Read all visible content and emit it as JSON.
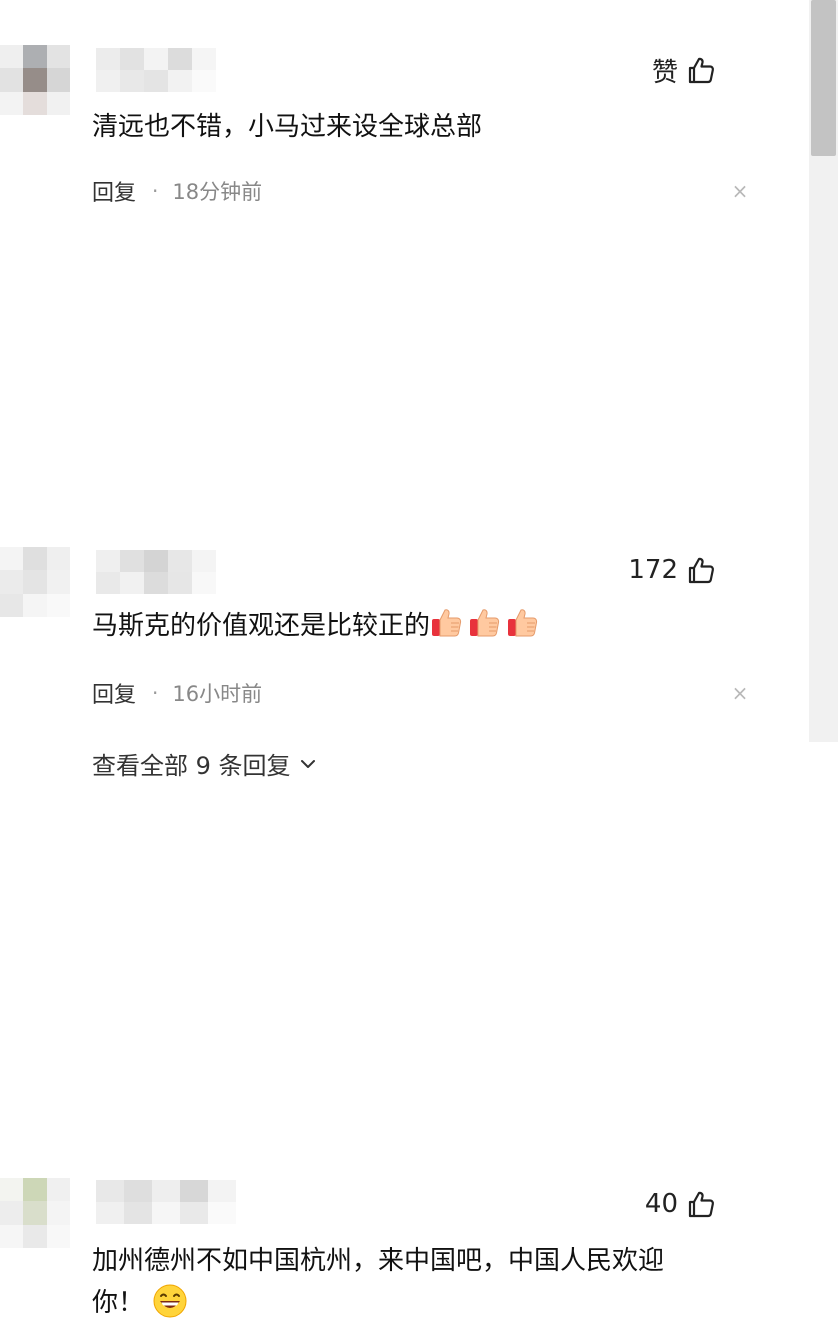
{
  "colors": {
    "text": "#111111",
    "meta": "#888888",
    "scroll_thumb": "#c3c3c3"
  },
  "comments": [
    {
      "like_label": "赞",
      "text": "清远也不错，小马过来设全球总部",
      "reply_label": "回复",
      "dot": "·",
      "time": "18分钟前",
      "close": "×"
    },
    {
      "like_label": "172",
      "text": "马斯克的价值观还是比较正的",
      "reply_label": "回复",
      "dot": "·",
      "time": "16小时前",
      "close": "×",
      "view_replies": "查看全部 9 条回复",
      "emoji": [
        "thumbs-up",
        "thumbs-up",
        "thumbs-up"
      ]
    },
    {
      "like_label": "40",
      "text_line1": "加州德州不如中国杭州，来中国吧，中国人民欢迎",
      "text_line2": "你！",
      "emoji": [
        "grinning-face"
      ]
    }
  ]
}
